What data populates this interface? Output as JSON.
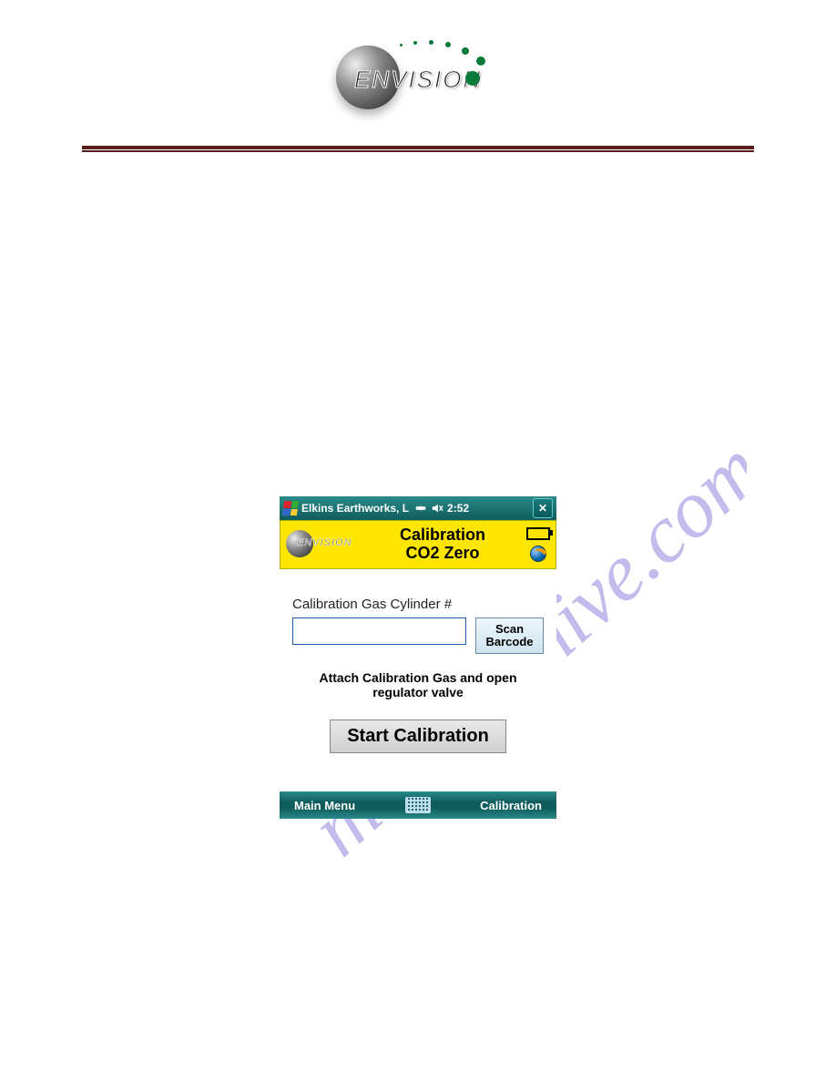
{
  "logo_text": "ENVISION",
  "titlebar": {
    "title": "Elkins Earthworks, L",
    "time": "2:52"
  },
  "header": {
    "line1": "Calibration",
    "line2": "CO2 Zero"
  },
  "form": {
    "cylinder_label": "Calibration Gas Cylinder #",
    "cylinder_value": "",
    "scan_label": "Scan\nBarcode",
    "instruction": "Attach Calibration Gas and open regulator valve",
    "start_label": "Start Calibration"
  },
  "bottombar": {
    "left": "Main Menu",
    "right": "Calibration"
  },
  "watermark_text": "manualshive.com"
}
